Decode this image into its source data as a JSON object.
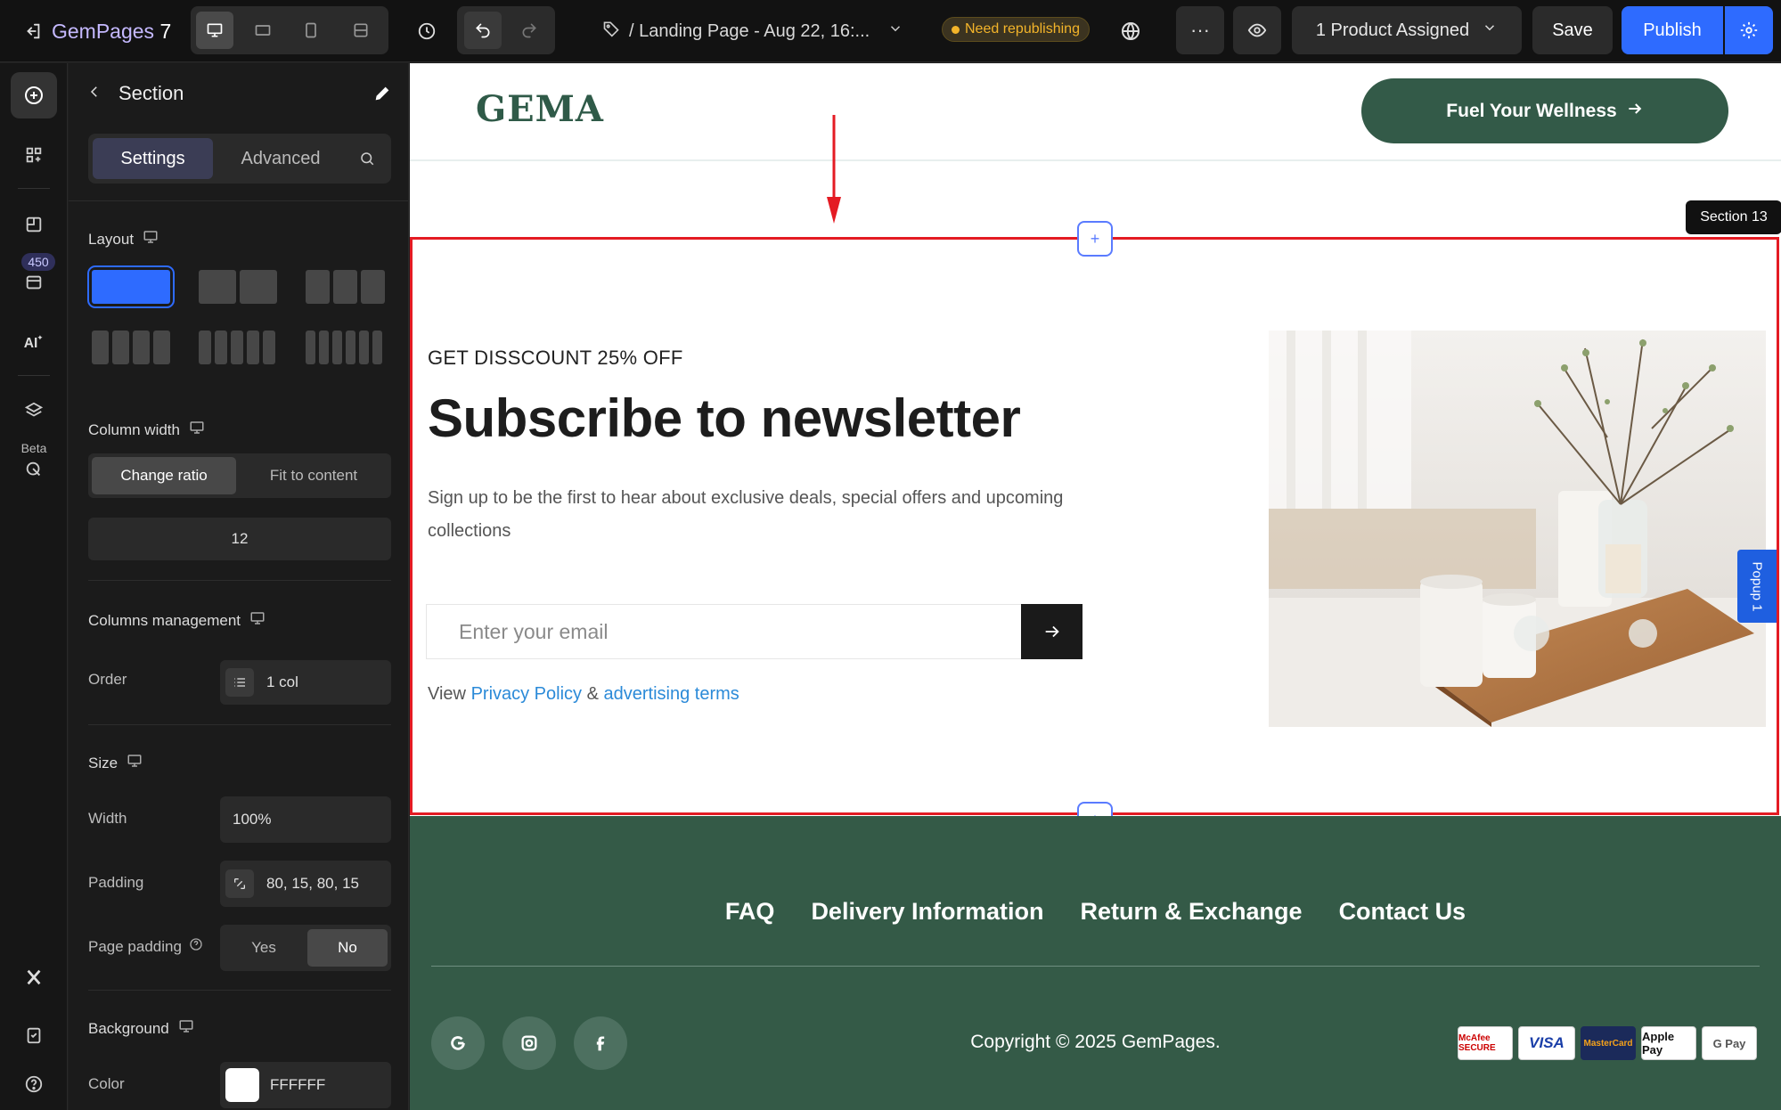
{
  "topbar": {
    "brand": "GemPages",
    "brand_version": "7",
    "page_title": "/ Landing Page - Aug 22, 16:...",
    "badge": "Need republishing",
    "product": "1 Product Assigned",
    "save": "Save",
    "publish": "Publish",
    "more": "···"
  },
  "rail": {
    "count_badge": "450",
    "beta": "Beta"
  },
  "panel": {
    "title": "Section",
    "tabs": [
      "Settings",
      "Advanced"
    ],
    "layout_label": "Layout",
    "column_width_label": "Column width",
    "column_width_options": [
      "Change ratio",
      "Fit to content"
    ],
    "column_width_value": "12",
    "columns_management_label": "Columns management",
    "order_label": "Order",
    "order_value": "1 col",
    "size_label": "Size",
    "width_label": "Width",
    "width_value": "100%",
    "padding_label": "Padding",
    "padding_value": "80, 15, 80, 15",
    "page_padding_label": "Page padding",
    "page_padding_options": [
      "Yes",
      "No"
    ],
    "background_label": "Background",
    "color_label": "Color",
    "color_value": "FFFFFF"
  },
  "canvas": {
    "logo": "GEMA",
    "cta": "Fuel Your Wellness",
    "section_tag": "Section 13",
    "kicker": "GET DISSCOUNT 25% OFF",
    "headline": "Subscribe to newsletter",
    "sub": "Sign up to be the first to hear about exclusive deals, special offers and upcoming collections",
    "email_placeholder": "Enter your email",
    "legal_prefix": "View",
    "legal_link1": "Privacy Policy",
    "legal_amp": "&",
    "legal_link2": "advertising terms",
    "popup_tab": "Popup 1"
  },
  "footer": {
    "links": [
      "FAQ",
      "Delivery Information",
      "Return & Exchange",
      "Contact Us"
    ],
    "copyright": "Copyright © 2025 GemPages.",
    "payments": [
      "McAfee SECURE",
      "VISA",
      "MasterCard",
      "Apple Pay",
      "G Pay"
    ]
  },
  "colors": {
    "accent": "#2e6bff",
    "brand_green": "#345a47",
    "selection_red": "#e41b23",
    "warning": "#f3b42a",
    "link": "#2b8ad8"
  }
}
